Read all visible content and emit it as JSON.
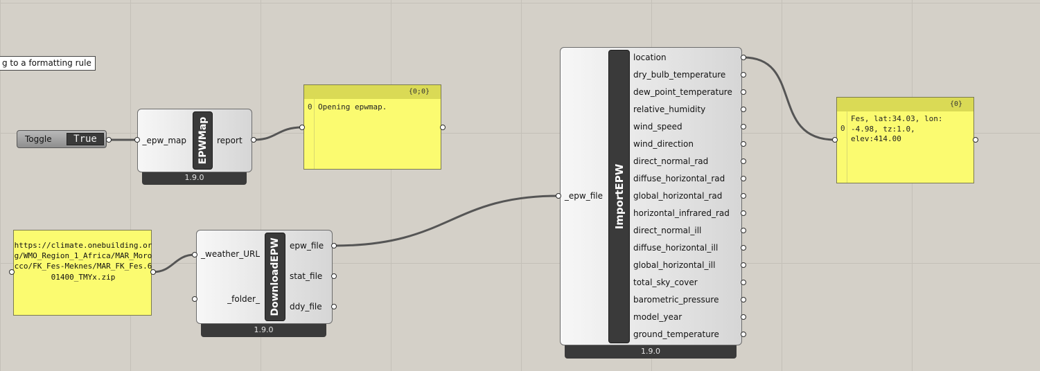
{
  "tooltip": {
    "text": "g to a formatting rule"
  },
  "toggle": {
    "label": "Toggle",
    "value": "True"
  },
  "epwmap": {
    "title": "EPWMap",
    "input": "_epw_map",
    "output": "report",
    "version": "1.9.0"
  },
  "panel_report": {
    "header": "{0;0}",
    "index": "0",
    "text": "Opening epwmap."
  },
  "url_panel": {
    "text": "https://climate.onebuilding.org/WMO_Region_1_Africa/MAR_Morocco/FK_Fes-Meknes/MAR_FK_Fes.601400_TMYx.zip"
  },
  "download_epw": {
    "title": "DownloadEPW",
    "inputs": [
      "_weather_URL",
      "_folder_"
    ],
    "outputs": [
      "epw_file",
      "stat_file",
      "ddy_file"
    ],
    "version": "1.9.0"
  },
  "import_epw": {
    "title": "ImportEPW",
    "input": "_epw_file",
    "outputs": [
      "location",
      "dry_bulb_temperature",
      "dew_point_temperature",
      "relative_humidity",
      "wind_speed",
      "wind_direction",
      "direct_normal_rad",
      "diffuse_horizontal_rad",
      "global_horizontal_rad",
      "horizontal_infrared_rad",
      "direct_normal_ill",
      "diffuse_horizontal_ill",
      "global_horizontal_ill",
      "total_sky_cover",
      "barometric_pressure",
      "model_year",
      "ground_temperature"
    ],
    "version": "1.9.0"
  },
  "panel_location": {
    "header": "{0}",
    "index": "0",
    "text": "Fes, lat:34.03, lon:\n-4.98, tz:1.0,\nelev:414.00"
  },
  "colors": {
    "canvas": "#d4d0c8",
    "panel": "#fbfb70",
    "component_band": "#3a3a3a",
    "wire": "#555555"
  }
}
